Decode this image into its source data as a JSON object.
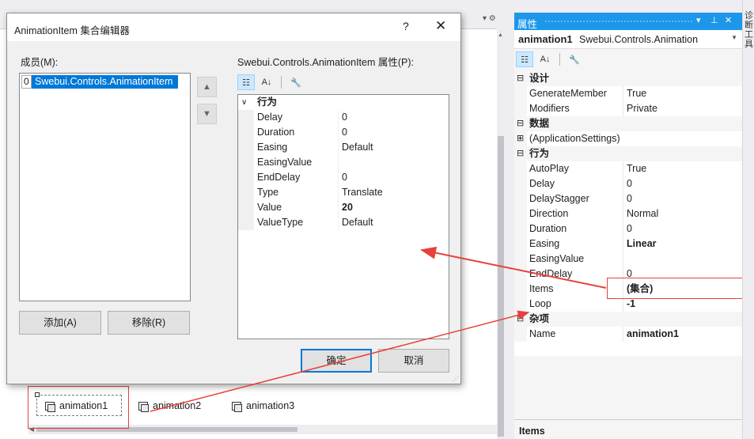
{
  "dialog": {
    "title": "AnimationItem 集合编辑器",
    "help": "?",
    "close": "✕",
    "members_label": "成员(M):",
    "members": [
      {
        "index": "0",
        "label": "Swebui.Controls.AnimationItem"
      }
    ],
    "up_glyph": "▲",
    "down_glyph": "▼",
    "add_button": "添加(A)",
    "remove_button": "移除(R)",
    "props_label": "Swebui.Controls.AnimationItem 属性(P):",
    "category": "行为",
    "properties": [
      {
        "name": "Delay",
        "value": "0"
      },
      {
        "name": "Duration",
        "value": "0"
      },
      {
        "name": "Easing",
        "value": "Default"
      },
      {
        "name": "EasingValue",
        "value": ""
      },
      {
        "name": "EndDelay",
        "value": "0"
      },
      {
        "name": "Type",
        "value": "Translate"
      },
      {
        "name": "Value",
        "value": "20"
      },
      {
        "name": "ValueType",
        "value": "Default"
      }
    ],
    "ok_button": "确定",
    "cancel_button": "取消"
  },
  "toolbar_icons": {
    "categorized": "categorized-icon",
    "alphabetical": "alphabetical-icon",
    "property_pages": "wrench-icon"
  },
  "tray": {
    "items": [
      "animation1",
      "animation2",
      "animation3"
    ]
  },
  "properties_panel": {
    "title": "属性",
    "object_name": "animation1",
    "object_type": "Swebui.Controls.Animation",
    "categories": [
      {
        "label": "设计",
        "rows": [
          {
            "name": "GenerateMember",
            "value": "True"
          },
          {
            "name": "Modifiers",
            "value": "Private"
          }
        ]
      },
      {
        "label": "数据",
        "rows": [
          {
            "name": "(ApplicationSettings)",
            "value": ""
          }
        ]
      },
      {
        "label": "行为",
        "rows": [
          {
            "name": "AutoPlay",
            "value": "True"
          },
          {
            "name": "Delay",
            "value": "0"
          },
          {
            "name": "DelayStagger",
            "value": "0"
          },
          {
            "name": "Direction",
            "value": "Normal"
          },
          {
            "name": "Duration",
            "value": "0"
          },
          {
            "name": "Easing",
            "value": "Linear"
          },
          {
            "name": "EasingValue",
            "value": ""
          },
          {
            "name": "EndDelay",
            "value": "0"
          },
          {
            "name": "Items",
            "value": "(集合)"
          },
          {
            "name": "Loop",
            "value": "-1"
          }
        ]
      },
      {
        "label": "杂项",
        "rows": [
          {
            "name": "Name",
            "value": "animation1"
          }
        ]
      }
    ],
    "description_title": "Items"
  },
  "side_tab": "诊断工具",
  "colors": {
    "accent": "#1c97ea",
    "selection": "#0078d7",
    "annotation": "#e8403a"
  }
}
